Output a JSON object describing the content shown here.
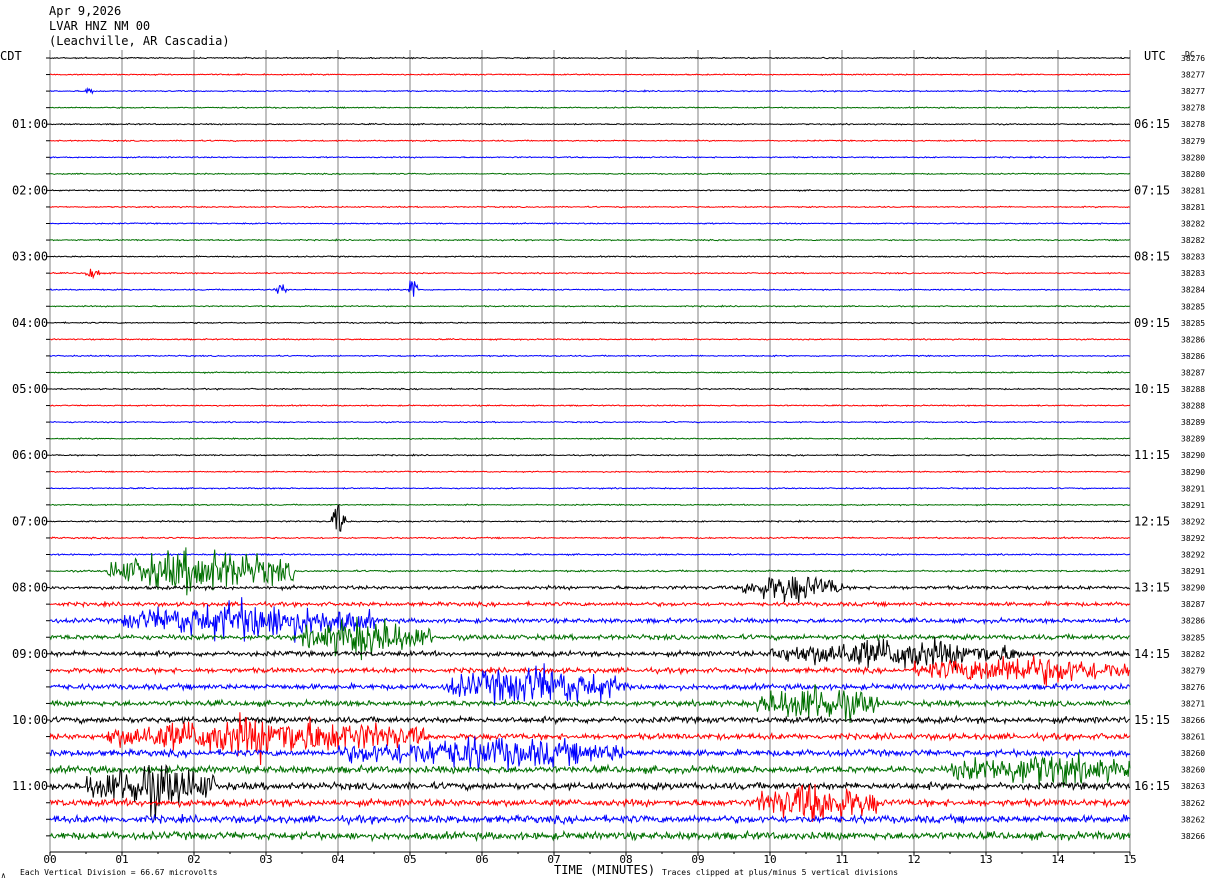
{
  "header": {
    "date": "Apr 9,2026",
    "station": "LVAR HNZ NM 00",
    "location": "(Leachville, AR Cascadia)"
  },
  "left_tz": "CDT",
  "right_tz": "UTC",
  "dc_label": "DC",
  "footer": {
    "scale_note": "Each Vertical Division =   66.67 microvolts",
    "clip_note": "Traces clipped at plus/minus 5 vertical divisions",
    "corner_mark": "∧"
  },
  "colors": {
    "trace_cycle": [
      "#000000",
      "#ff0000",
      "#0000ff",
      "#007000"
    ],
    "grid": "#808080"
  },
  "chart_data": {
    "type": "line",
    "title": "LVAR HNZ NM 00",
    "xlabel": "TIME (MINUTES)",
    "xlim": [
      0,
      15
    ],
    "x_ticks": [
      "00",
      "01",
      "02",
      "03",
      "04",
      "05",
      "06",
      "07",
      "08",
      "09",
      "10",
      "11",
      "12",
      "13",
      "14",
      "15"
    ],
    "left_hour_labels": [
      "01:00",
      "02:00",
      "03:00",
      "04:00",
      "05:00",
      "06:00",
      "07:00",
      "08:00",
      "09:00",
      "10:00",
      "11:00"
    ],
    "right_hour_labels": [
      "06:15",
      "07:15",
      "08:15",
      "09:15",
      "10:15",
      "11:15",
      "12:15",
      "13:15",
      "14:15",
      "15:15",
      "16:15"
    ],
    "dc_offsets": [
      "38276",
      "38277",
      "38277",
      "38278",
      "38278",
      "38279",
      "38280",
      "38280",
      "38281",
      "38281",
      "38282",
      "38282",
      "38283",
      "38283",
      "38284",
      "38285",
      "38285",
      "38286",
      "38286",
      "38287",
      "38288",
      "38288",
      "38289",
      "38289",
      "38290",
      "38290",
      "38291",
      "38291",
      "38292",
      "38292",
      "38292",
      "38291",
      "38290",
      "38287",
      "38286",
      "38285",
      "38282",
      "38279",
      "38276",
      "38271",
      "38266",
      "38261",
      "38260",
      "38260",
      "38263",
      "38262",
      "38262",
      "38266"
    ],
    "trace_count": 48,
    "minutes_per_trace": 15,
    "noise_level_divisions": [
      0.25,
      0.25,
      0.25,
      0.25,
      0.25,
      0.25,
      0.25,
      0.25,
      0.25,
      0.25,
      0.25,
      0.25,
      0.25,
      0.25,
      0.25,
      0.25,
      0.25,
      0.25,
      0.25,
      0.25,
      0.25,
      0.25,
      0.25,
      0.25,
      0.25,
      0.25,
      0.25,
      0.25,
      0.28,
      0.3,
      0.3,
      0.35,
      0.7,
      0.8,
      0.9,
      1.0,
      1.0,
      1.0,
      1.1,
      1.1,
      1.2,
      1.2,
      1.3,
      1.4,
      1.4,
      1.4,
      1.5,
      1.5
    ],
    "events": [
      {
        "trace": 2,
        "start": 0.5,
        "end": 0.6,
        "amp": 1.5
      },
      {
        "trace": 13,
        "start": 0.5,
        "end": 0.7,
        "amp": 1.5
      },
      {
        "trace": 14,
        "start": 4.98,
        "end": 5.1,
        "amp": 6
      },
      {
        "trace": 14,
        "start": 3.1,
        "end": 3.3,
        "amp": 1.5
      },
      {
        "trace": 28,
        "start": 3.9,
        "end": 4.1,
        "amp": 4
      },
      {
        "trace": 31,
        "start": 0.8,
        "end": 3.4,
        "amp": 5
      },
      {
        "trace": 32,
        "start": 9.6,
        "end": 11.0,
        "amp": 3
      },
      {
        "trace": 34,
        "start": 1.0,
        "end": 4.5,
        "amp": 4
      },
      {
        "trace": 35,
        "start": 3.5,
        "end": 5.3,
        "amp": 4
      },
      {
        "trace": 36,
        "start": 10.0,
        "end": 13.5,
        "amp": 3
      },
      {
        "trace": 37,
        "start": 12.0,
        "end": 15.0,
        "amp": 3
      },
      {
        "trace": 38,
        "start": 5.5,
        "end": 8.0,
        "amp": 4
      },
      {
        "trace": 39,
        "start": 9.8,
        "end": 11.5,
        "amp": 4
      },
      {
        "trace": 41,
        "start": 0.8,
        "end": 5.2,
        "amp": 4
      },
      {
        "trace": 42,
        "start": 4.0,
        "end": 8.0,
        "amp": 3
      },
      {
        "trace": 43,
        "start": 12.5,
        "end": 15.0,
        "amp": 3
      },
      {
        "trace": 44,
        "start": 0.5,
        "end": 2.3,
        "amp": 5
      },
      {
        "trace": 45,
        "start": 9.8,
        "end": 11.5,
        "amp": 4
      }
    ]
  }
}
